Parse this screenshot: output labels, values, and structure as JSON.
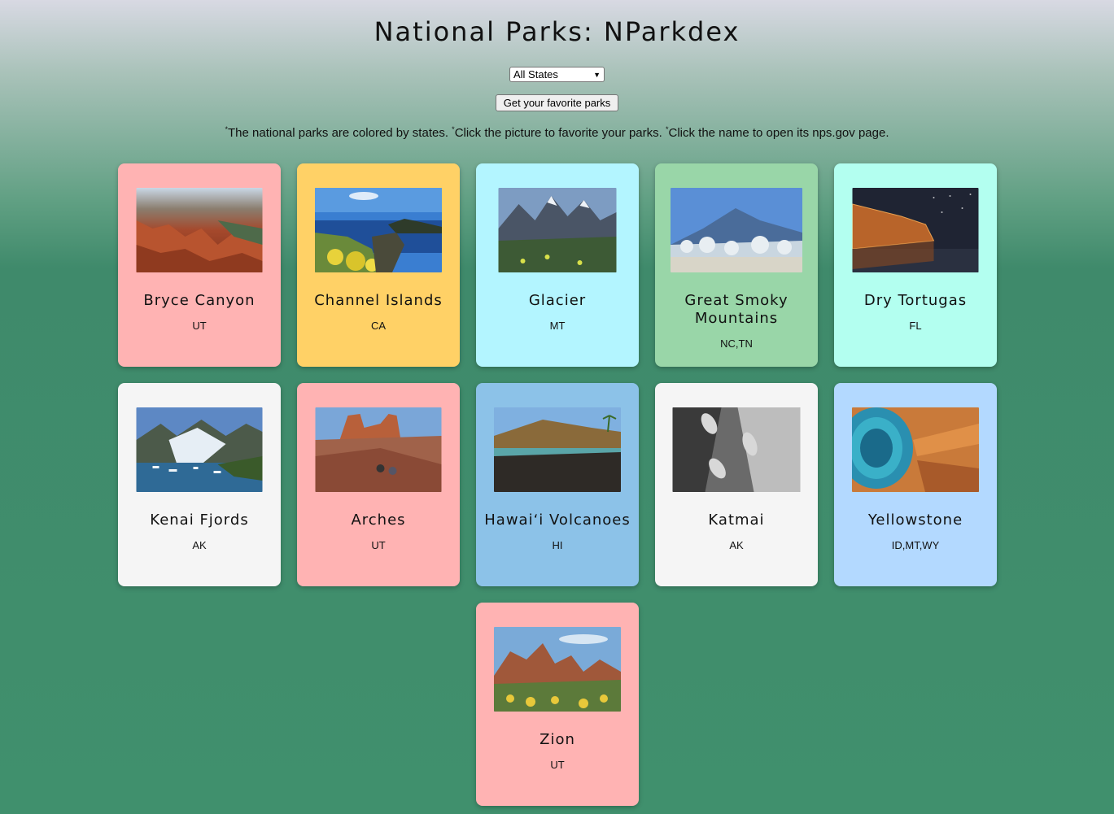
{
  "header": {
    "title": "National Parks: NParkdex"
  },
  "controls": {
    "state_select_value": "All States",
    "favorites_button_label": "Get your favorite parks"
  },
  "notes": {
    "marker": "*",
    "note1": "The national parks are colored by states. ",
    "note2": "Click the picture to favorite your parks. ",
    "note3": "Click the name to open its nps.gov page."
  },
  "parks": [
    {
      "name": "Bryce Canyon",
      "states": "UT",
      "card_color": "#ffb3b3"
    },
    {
      "name": "Channel Islands",
      "states": "CA",
      "card_color": "#ffd166"
    },
    {
      "name": "Glacier",
      "states": "MT",
      "card_color": "#b3f5ff"
    },
    {
      "name": "Great Smoky Mountains",
      "states": "NC,TN",
      "card_color": "#99d6a8"
    },
    {
      "name": "Dry Tortugas",
      "states": "FL",
      "card_color": "#b3fff0"
    },
    {
      "name": "Kenai Fjords",
      "states": "AK",
      "card_color": "#f5f5f5"
    },
    {
      "name": "Arches",
      "states": "UT",
      "card_color": "#ffb3b3"
    },
    {
      "name": "Hawaiʻi Volcanoes",
      "states": "HI",
      "card_color": "#8cc2e8"
    },
    {
      "name": "Katmai",
      "states": "AK",
      "card_color": "#f5f5f5"
    },
    {
      "name": "Yellowstone",
      "states": "ID,MT,WY",
      "card_color": "#b3d9ff"
    },
    {
      "name": "Zion",
      "states": "UT",
      "card_color": "#ffb3b3"
    }
  ]
}
